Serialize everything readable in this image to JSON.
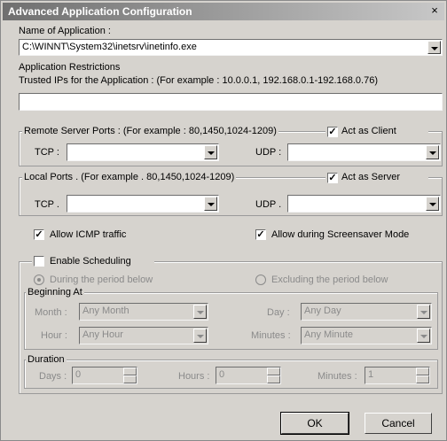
{
  "window": {
    "title": "Advanced Application Configuration",
    "close": "×"
  },
  "app": {
    "label": "Name of Application :",
    "value": "C:\\WINNT\\System32\\inetsrv\\inetinfo.exe"
  },
  "restrictions": {
    "title": "Application Restrictions",
    "trusted_label": "Trusted IPs for the Application :  (For example : 10.0.0.1, 192.168.0.1-192.168.0.76)",
    "trusted_value": ""
  },
  "remote": {
    "title": "Remote Server Ports :  (For example : 80,1450,1024-1209)",
    "client_label": "Act as Client",
    "client_checked": "✓",
    "tcp_label": "TCP :",
    "udp_label": "UDP :",
    "tcp_value": "",
    "udp_value": ""
  },
  "local": {
    "title": "Local Ports . (For example . 80,1450,1024-1209)",
    "server_label": "Act as Server",
    "server_checked": "✓",
    "tcp_label": "TCP .",
    "udp_label": "UDP .",
    "tcp_value": "",
    "udp_value": ""
  },
  "options": {
    "icmp_label": "Allow ICMP traffic",
    "icmp_checked": "✓",
    "screensaver_label": "Allow during Screensaver Mode",
    "screensaver_checked": "✓"
  },
  "scheduling": {
    "enable_label": "Enable Scheduling",
    "enable_checked": "",
    "during_label": "During the period below",
    "excluding_label": "Excluding the period below",
    "beginning_title": "Beginning At",
    "month_label": "Month :",
    "month_value": "Any Month",
    "day_label": "Day :",
    "day_value": "Any Day",
    "hour_label": "Hour :",
    "hour_value": "Any Hour",
    "minutes_label": "Minutes :",
    "minutes_value": "Any Minute",
    "duration_title": "Duration",
    "days_label": "Days :",
    "days_value": "0",
    "hours_label": "Hours :",
    "hours_value": "0",
    "dmin_label": "Minutes :",
    "dmin_value": "1"
  },
  "buttons": {
    "ok": "OK",
    "cancel": "Cancel"
  }
}
